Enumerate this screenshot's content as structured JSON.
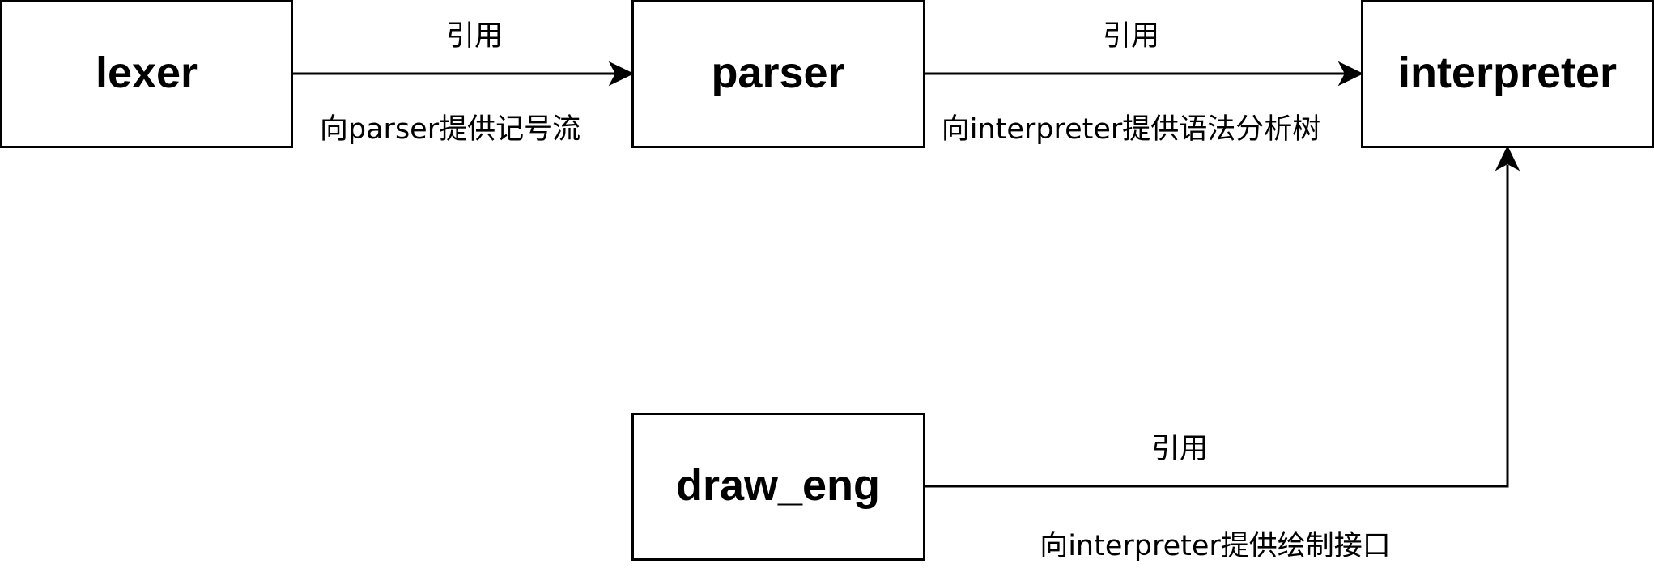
{
  "nodes": {
    "lexer": {
      "label": "lexer"
    },
    "parser": {
      "label": "parser"
    },
    "interpreter": {
      "label": "interpreter"
    },
    "draw_eng": {
      "label": "draw_eng"
    }
  },
  "edges": {
    "lexer_parser": {
      "top_label": "引用",
      "bottom_label": "向parser提供记号流"
    },
    "parser_interpreter": {
      "top_label": "引用",
      "bottom_label": "向interpreter提供语法分析树"
    },
    "draw_eng_interpreter": {
      "top_label": "引用",
      "bottom_label": "向interpreter提供绘制接口"
    }
  }
}
